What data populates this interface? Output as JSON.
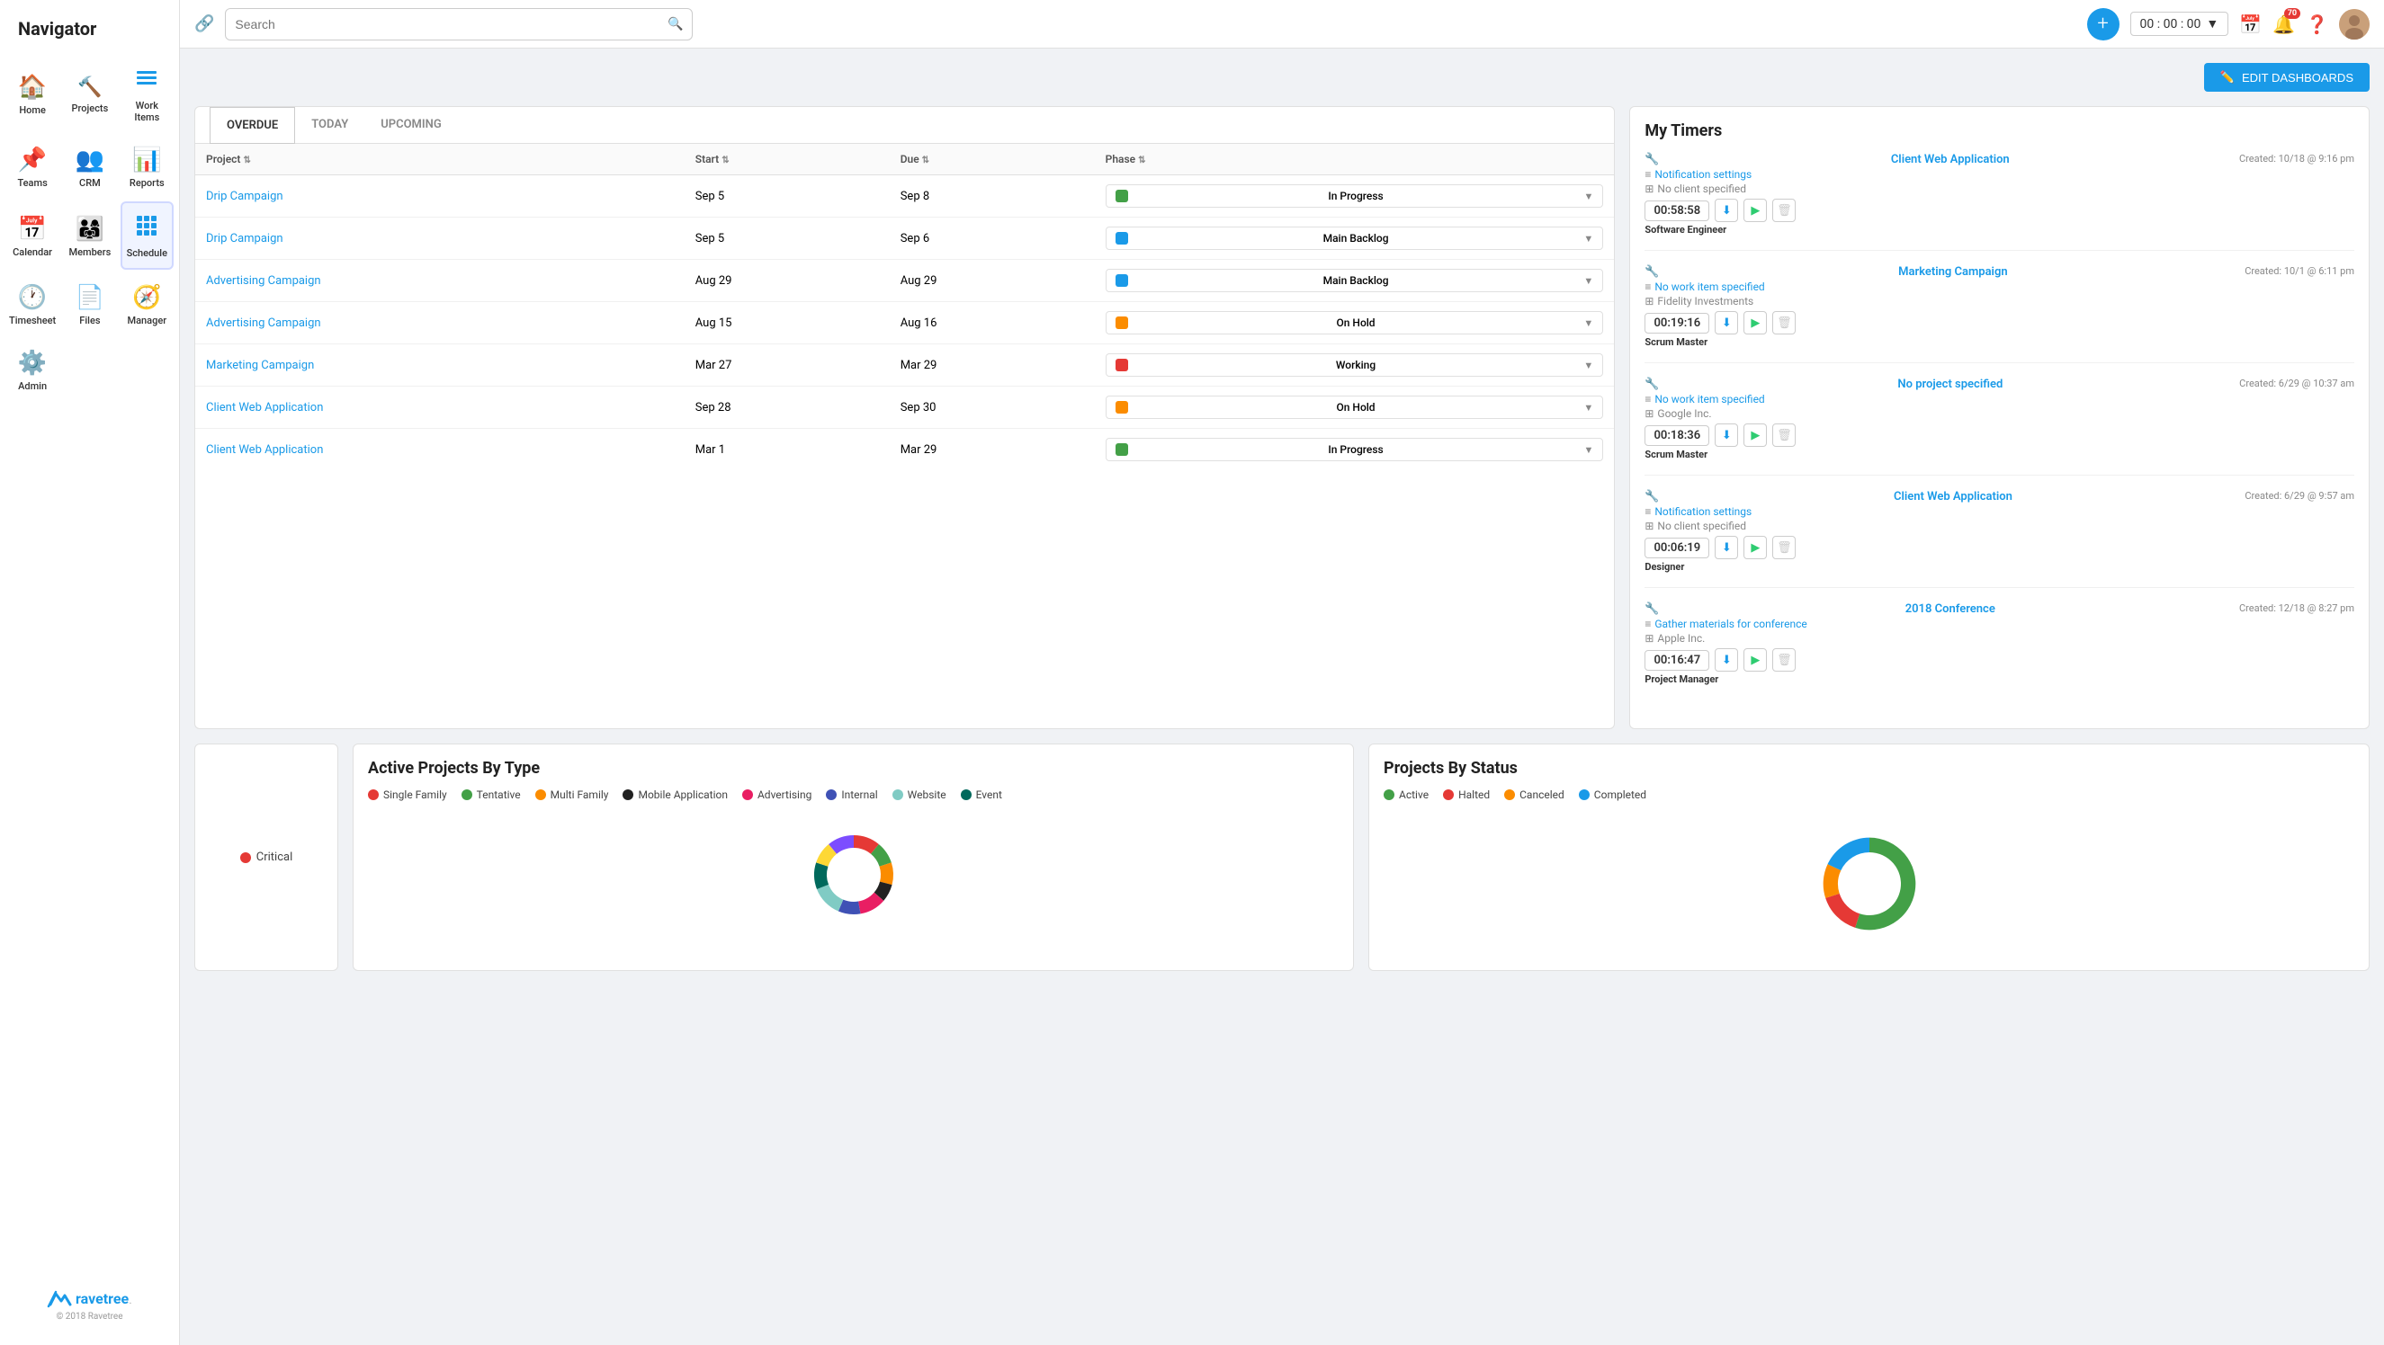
{
  "app": {
    "title": "Navigator"
  },
  "nav": {
    "items": [
      {
        "id": "home",
        "label": "Home",
        "icon": "🏠"
      },
      {
        "id": "projects",
        "label": "Projects",
        "icon": "🔧"
      },
      {
        "id": "work-items",
        "label": "Work Items",
        "icon": "≡"
      },
      {
        "id": "teams",
        "label": "Teams",
        "icon": "📌"
      },
      {
        "id": "crm",
        "label": "CRM",
        "icon": "👥"
      },
      {
        "id": "reports",
        "label": "Reports",
        "icon": "📊"
      },
      {
        "id": "calendar",
        "label": "Calendar",
        "icon": "📅"
      },
      {
        "id": "members",
        "label": "Members",
        "icon": "👨‍👩‍👧‍👦"
      },
      {
        "id": "schedule",
        "label": "Schedule",
        "icon": "⊞"
      },
      {
        "id": "timesheet",
        "label": "Timesheet",
        "icon": "🕐"
      },
      {
        "id": "files",
        "label": "Files",
        "icon": "📄"
      },
      {
        "id": "manager",
        "label": "Manager",
        "icon": "🧭"
      },
      {
        "id": "admin",
        "label": "Admin",
        "icon": "⚙️"
      }
    ]
  },
  "topbar": {
    "search_placeholder": "Search",
    "timer_value": "00 : 00 : 00",
    "notification_badge": "70",
    "add_label": "+",
    "edit_dashboards_label": "EDIT DASHBOARDS"
  },
  "tabs": {
    "overdue": "OVERDUE",
    "today": "TODAY",
    "upcoming": "UPCOMING"
  },
  "table": {
    "headers": [
      "Project",
      "Start",
      "Due",
      "Phase"
    ],
    "rows": [
      {
        "project": "Drip Campaign",
        "start": "Sep 5",
        "due": "Sep 8",
        "phase": "In Progress",
        "phase_color": "#43a047"
      },
      {
        "project": "Drip Campaign",
        "start": "Sep 5",
        "due": "Sep 6",
        "phase": "Main Backlog",
        "phase_color": "#1a9ae8"
      },
      {
        "project": "Advertising Campaign",
        "start": "Aug 29",
        "due": "Aug 29",
        "phase": "Main Backlog",
        "phase_color": "#1a9ae8"
      },
      {
        "project": "Advertising Campaign",
        "start": "Aug 15",
        "due": "Aug 16",
        "phase": "On Hold",
        "phase_color": "#fb8c00"
      },
      {
        "project": "Marketing Campaign",
        "start": "Mar 27",
        "due": "Mar 29",
        "phase": "Working",
        "phase_color": "#e53935"
      },
      {
        "project": "Client Web Application",
        "start": "Sep 28",
        "due": "Sep 30",
        "phase": "On Hold",
        "phase_color": "#fb8c00"
      },
      {
        "project": "Client Web Application",
        "start": "Mar 1",
        "due": "Mar 29",
        "phase": "In Progress",
        "phase_color": "#43a047"
      }
    ]
  },
  "timers": {
    "title": "My Timers",
    "entries": [
      {
        "project": "Client Web Application",
        "created": "Created: 10/18 @ 9:16 pm",
        "workitem": "Notification settings",
        "client": "No client specified",
        "time": "00:58:58",
        "role": "Software Engineer"
      },
      {
        "project": "Marketing Campaign",
        "created": "Created: 10/1 @ 6:11 pm",
        "workitem": "No work item specified",
        "client": "Fidelity Investments",
        "time": "00:19:16",
        "role": "Scrum Master"
      },
      {
        "project": "No project specified",
        "created": "Created: 6/29 @ 10:37 am",
        "workitem": "No work item specified",
        "client": "Google Inc.",
        "time": "00:18:36",
        "role": "Scrum Master"
      },
      {
        "project": "Client Web Application",
        "created": "Created: 6/29 @ 9:57 am",
        "workitem": "Notification settings",
        "client": "No client specified",
        "time": "00:06:19",
        "role": "Designer"
      },
      {
        "project": "2018 Conference",
        "created": "Created: 12/18 @ 8:27 pm",
        "workitem": "Gather materials for conference",
        "client": "Apple Inc.",
        "time": "00:16:47",
        "role": "Project Manager"
      }
    ]
  },
  "active_projects": {
    "title": "Active Projects By Type",
    "legend": [
      {
        "label": "Single Family",
        "color": "#e53935"
      },
      {
        "label": "Tentative",
        "color": "#43a047"
      },
      {
        "label": "Multi Family",
        "color": "#fb8c00"
      },
      {
        "label": "Mobile Application",
        "color": "#212121"
      },
      {
        "label": "Advertising",
        "color": "#e91e63"
      },
      {
        "label": "Internal",
        "color": "#3f51b5"
      },
      {
        "label": "Website",
        "color": "#80cbc4"
      },
      {
        "label": "Event",
        "color": "#00695c"
      }
    ],
    "chart_segments": [
      {
        "color": "#e53935",
        "value": 12
      },
      {
        "color": "#43a047",
        "value": 10
      },
      {
        "color": "#fb8c00",
        "value": 10
      },
      {
        "color": "#212121",
        "value": 8
      },
      {
        "color": "#e91e63",
        "value": 12
      },
      {
        "color": "#3f51b5",
        "value": 10
      },
      {
        "color": "#80cbc4",
        "value": 14
      },
      {
        "color": "#00695c",
        "value": 12
      },
      {
        "color": "#fdd835",
        "value": 10
      },
      {
        "color": "#7c4dff",
        "value": 12
      }
    ]
  },
  "projects_status": {
    "title": "Projects By Status",
    "legend": [
      {
        "label": "Active",
        "color": "#43a047"
      },
      {
        "label": "Halted",
        "color": "#e53935"
      },
      {
        "label": "Canceled",
        "color": "#fb8c00"
      },
      {
        "label": "Completed",
        "color": "#1a9ae8"
      }
    ],
    "chart_segments": [
      {
        "color": "#43a047",
        "value": 55
      },
      {
        "color": "#e53935",
        "value": 15
      },
      {
        "color": "#fb8c00",
        "value": 12
      },
      {
        "color": "#1a9ae8",
        "value": 18
      }
    ]
  },
  "critical": {
    "label": "Critical"
  },
  "footer": {
    "brand": "ravetree.",
    "copy": "© 2018 Ravetree"
  }
}
